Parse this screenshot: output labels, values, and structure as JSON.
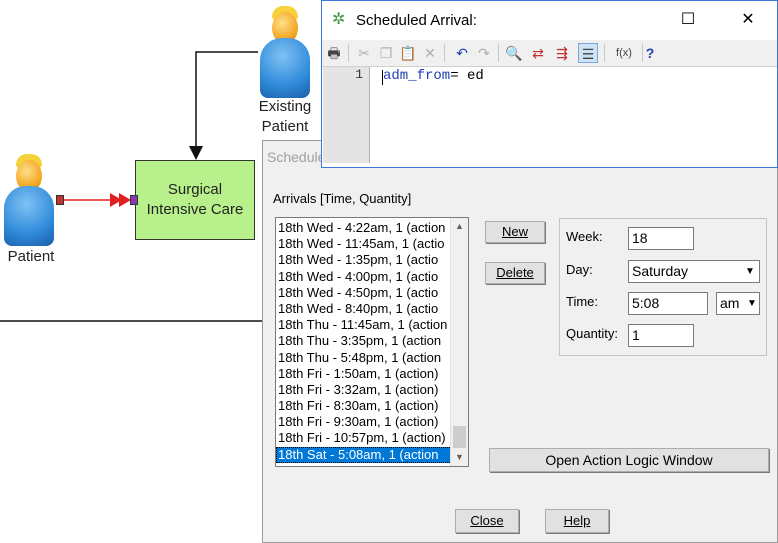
{
  "flowchart": {
    "existing_patient_label_line1": "Existing",
    "existing_patient_label_line2": "Patient",
    "patient_label": "Patient",
    "sic_line1": "Surgical",
    "sic_line2": "Intensive Care"
  },
  "dialog": {
    "title_partial": "Schedule",
    "arrivals_label": "Arrivals [Time, Quantity]",
    "arrivals": [
      "18th Wed -  4:22am, 1 (action",
      "18th Wed - 11:45am, 1 (actio",
      "18th Wed -  1:35pm, 1 (actio",
      "18th Wed -  4:00pm, 1 (actio",
      "18th Wed -  4:50pm, 1 (actio",
      "18th Wed -  8:40pm, 1 (actio",
      "18th Thu - 11:45am, 1 (action",
      "18th Thu -  3:35pm, 1 (action",
      "18th Thu -  5:48pm, 1 (action",
      "18th Fri -  1:50am, 1 (action)",
      "18th Fri -  3:32am, 1 (action)",
      "18th Fri -  8:30am, 1 (action)",
      "18th Fri -  9:30am, 1 (action)",
      "18th Fri - 10:57pm, 1 (action)",
      "18th Sat -  5:08am, 1 (action"
    ],
    "new_button": "New",
    "delete_button": "Delete",
    "week_label": "Week:",
    "week_value": "18",
    "day_label": "Day:",
    "day_value": "Saturday",
    "time_label": "Time:",
    "time_value": "5:08",
    "ampm_value": "am",
    "quantity_label": "Quantity:",
    "quantity_value": "1",
    "open_logic_button": "Open Action Logic Window",
    "close_button": "Close",
    "help_button": "Help"
  },
  "editor": {
    "title": "Scheduled Arrival:",
    "line_number": "1",
    "code_var": "adm_from",
    "code_rest": "= ed",
    "fx_label": "f(x)",
    "help_glyph": "?"
  },
  "colors": {
    "selection": "#0078d7",
    "sic_fill": "#b8f08c",
    "code_keyword": "#1f3fb0",
    "arrow_red": "#e02020"
  }
}
